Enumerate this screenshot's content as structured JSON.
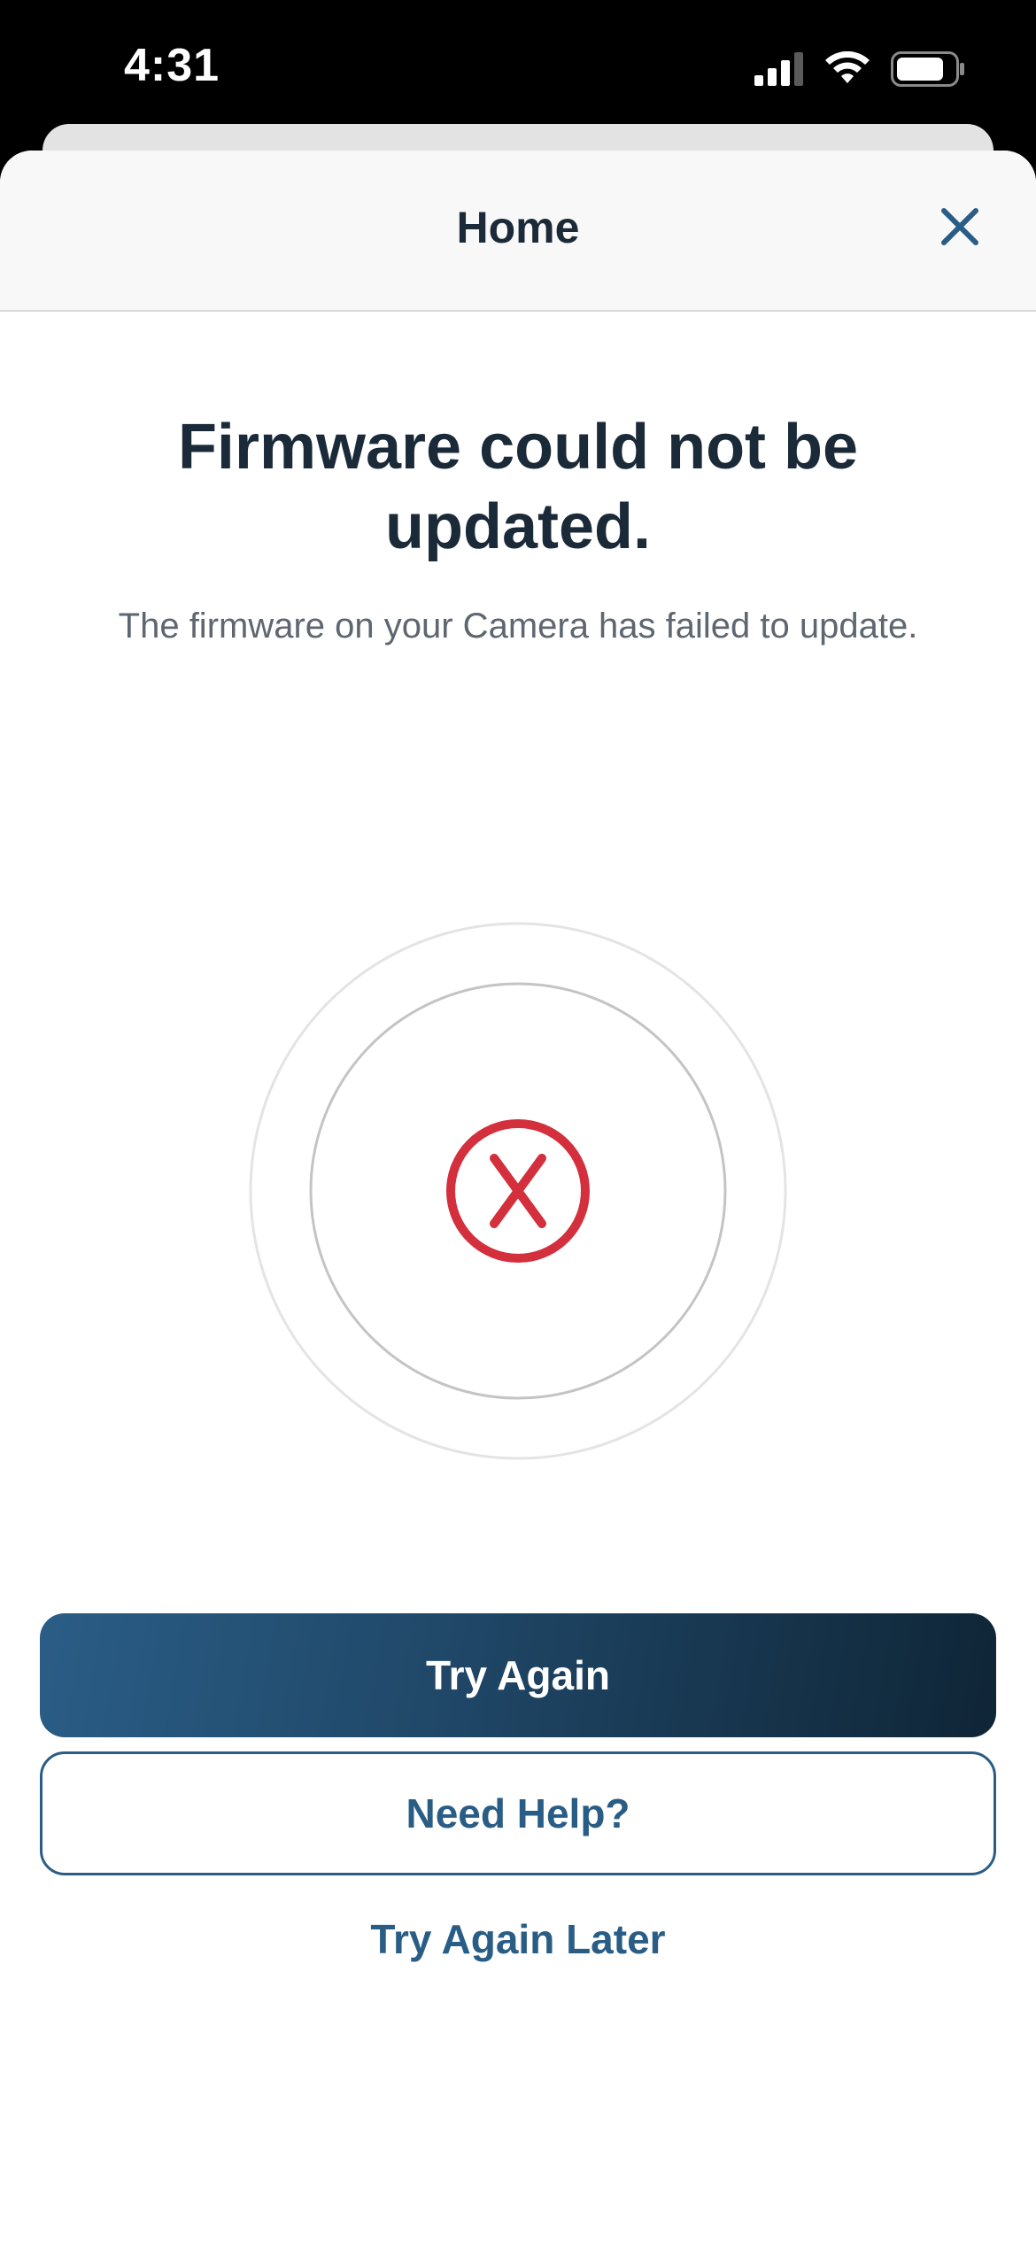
{
  "status_bar": {
    "time": "4:31"
  },
  "header": {
    "title": "Home",
    "close_icon": "close-icon"
  },
  "content": {
    "headline": "Firmware could not be updated.",
    "description": "The firmware on your Camera has failed to update.",
    "status_icon": "error-x-circle-icon"
  },
  "actions": {
    "primary_label": "Try Again",
    "secondary_label": "Need Help?",
    "tertiary_label": "Try Again Later"
  },
  "colors": {
    "brand": "#2a5d86",
    "brand_dark": "#0f2536",
    "error": "#d32f3c",
    "text": "#1b2a38",
    "muted_text": "#5e6670"
  }
}
